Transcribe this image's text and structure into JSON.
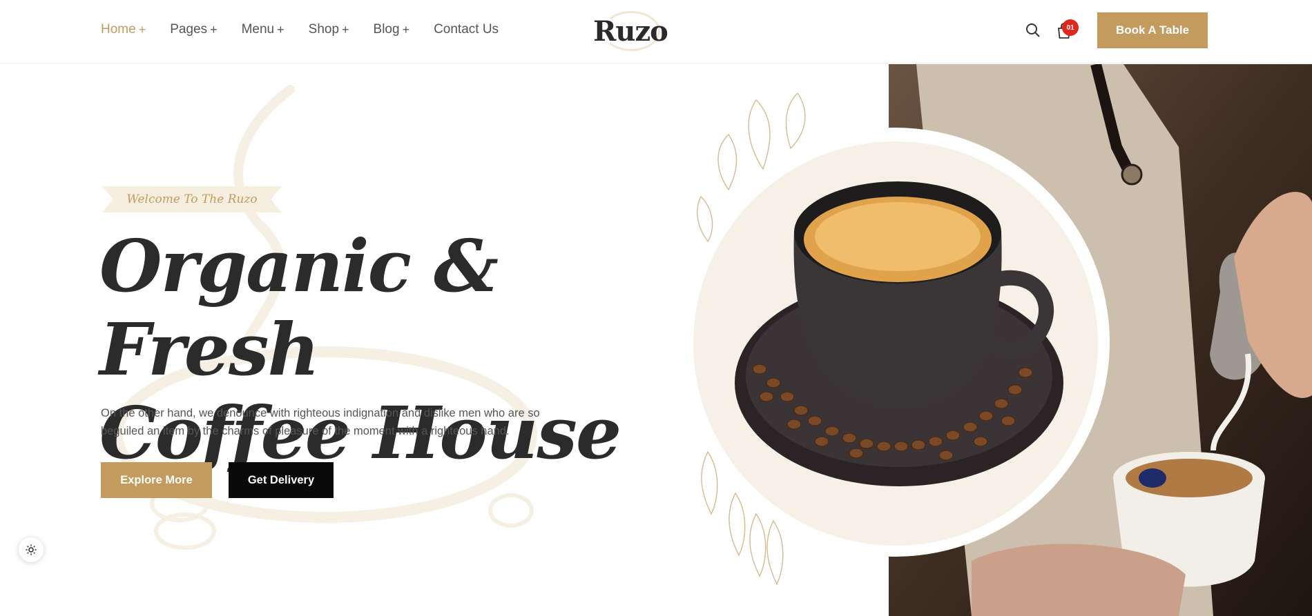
{
  "header": {
    "nav": [
      {
        "label": "Home",
        "suffix": "+"
      },
      {
        "label": "Pages",
        "suffix": "+"
      },
      {
        "label": "Menu",
        "suffix": "+"
      },
      {
        "label": "Shop",
        "suffix": "+"
      },
      {
        "label": "Blog",
        "suffix": "+"
      },
      {
        "label": "Contact Us",
        "suffix": ""
      }
    ],
    "logo_text": "Ruzo",
    "cart_count": "01",
    "book_label": "Book A Table"
  },
  "hero": {
    "tagline": "Welcome To The Ruzo",
    "title_line1": "Organic & Fresh",
    "title_line2": "Coffee House",
    "description": "On the other hand, we denounce with righteous indignation and dislike men who are so beguiled an item by the charms of pleasure of the moment with a righteous hand.",
    "explore_label": "Explore More",
    "delivery_label": "Get Delivery"
  },
  "colors": {
    "accent": "#c49b5f",
    "dark": "#2b2b2b",
    "badge": "#e0281f",
    "cream": "#f6f0e6"
  },
  "icons": [
    "search-icon",
    "cart-icon",
    "sun-icon"
  ]
}
